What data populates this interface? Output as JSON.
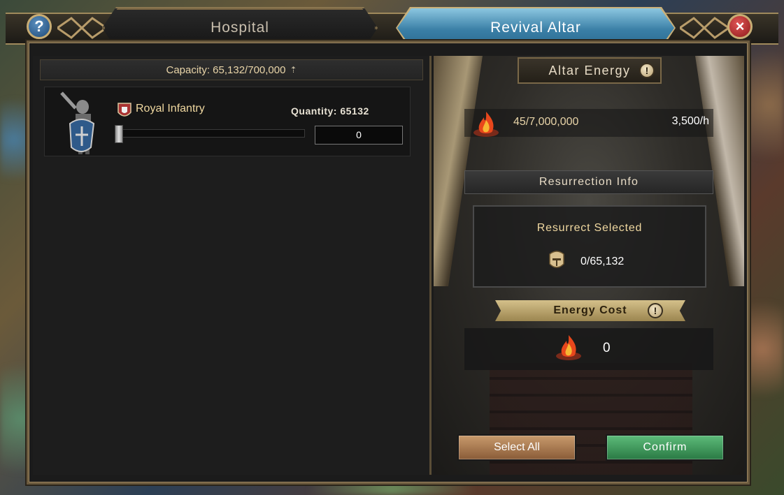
{
  "tabs": {
    "hospital": "Hospital",
    "revival_altar": "Revival Altar",
    "active": "revival_altar"
  },
  "header": {
    "help_icon": "?",
    "close_icon": "×"
  },
  "left": {
    "capacity": "Capacity: 65,132/700,000",
    "troop": {
      "name": "Royal Infantry",
      "quantity_label": "Quantity: 65132",
      "input_value": "0",
      "slider_fraction": 0
    }
  },
  "right": {
    "altar_energy_title": "Altar Energy",
    "altar_energy_value": "45/7,000,000",
    "altar_energy_rate": "3,500/h",
    "resurrection_info_title": "Resurrection Info",
    "resurrect_selected_label": "Resurrect Selected",
    "resurrect_selected_value": "0/65,132",
    "energy_cost_title": "Energy Cost",
    "energy_cost_value": "0",
    "info_glyph": "!",
    "select_all_label": "Select All",
    "confirm_label": "Confirm"
  },
  "colors": {
    "accent_gold": "#e8d4a8",
    "active_tab_blue": "#3a7fa6",
    "confirm_green": "#2a7a44",
    "select_all_tan": "#8a5c38",
    "close_red": "#8e1a1a",
    "help_blue": "#1e4a78"
  }
}
